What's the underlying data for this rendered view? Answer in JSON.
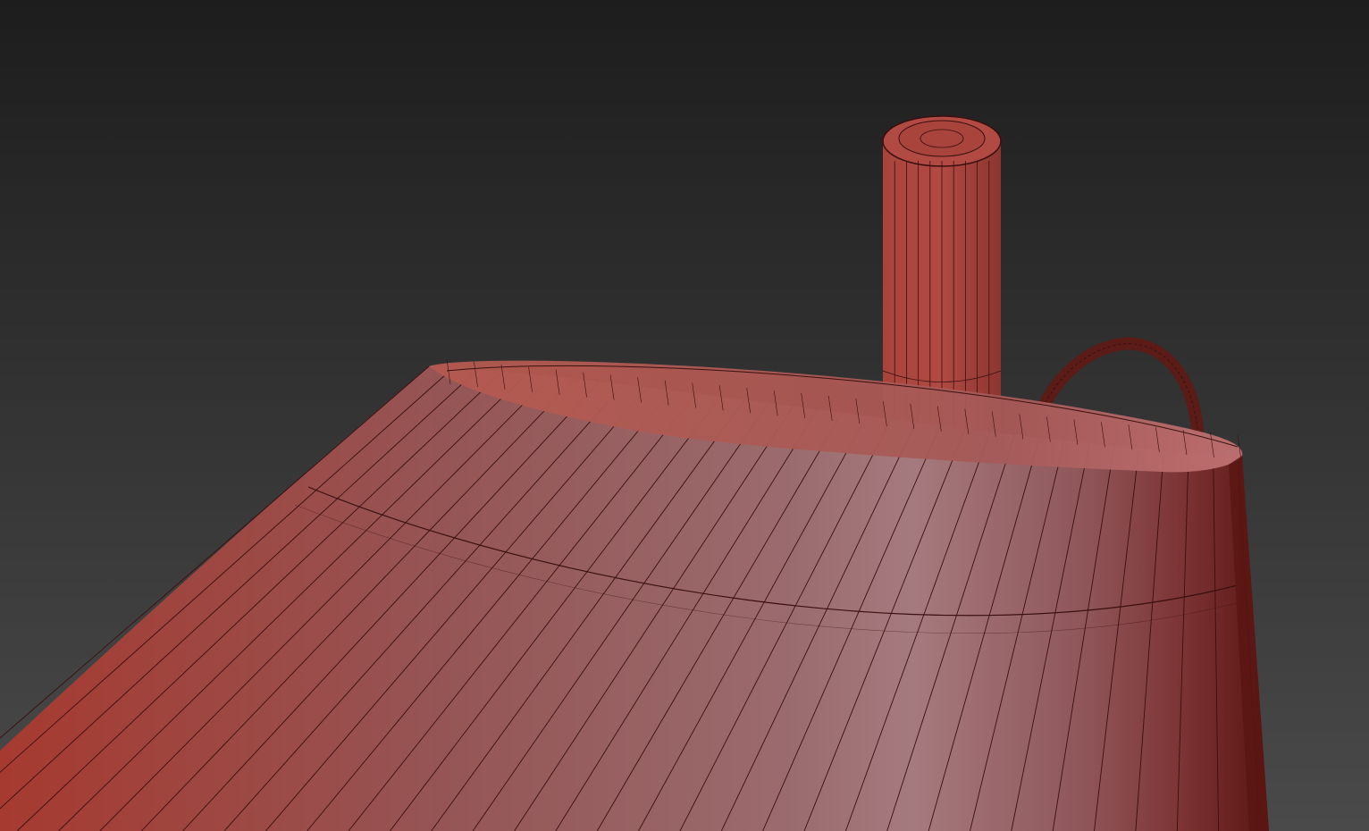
{
  "viewport": {
    "background_top": "#1d1d1d",
    "background_bottom": "#4a4a4a",
    "wire_color": "#3a0f0f"
  },
  "model": {
    "shade_color_dark": "#a63a30",
    "shade_color_mid": "#955555",
    "shade_color_light": "#a57a7e",
    "interior_color": "#5a1613",
    "rod_color": "#a8443c",
    "handle_color": "#5b1c17"
  }
}
